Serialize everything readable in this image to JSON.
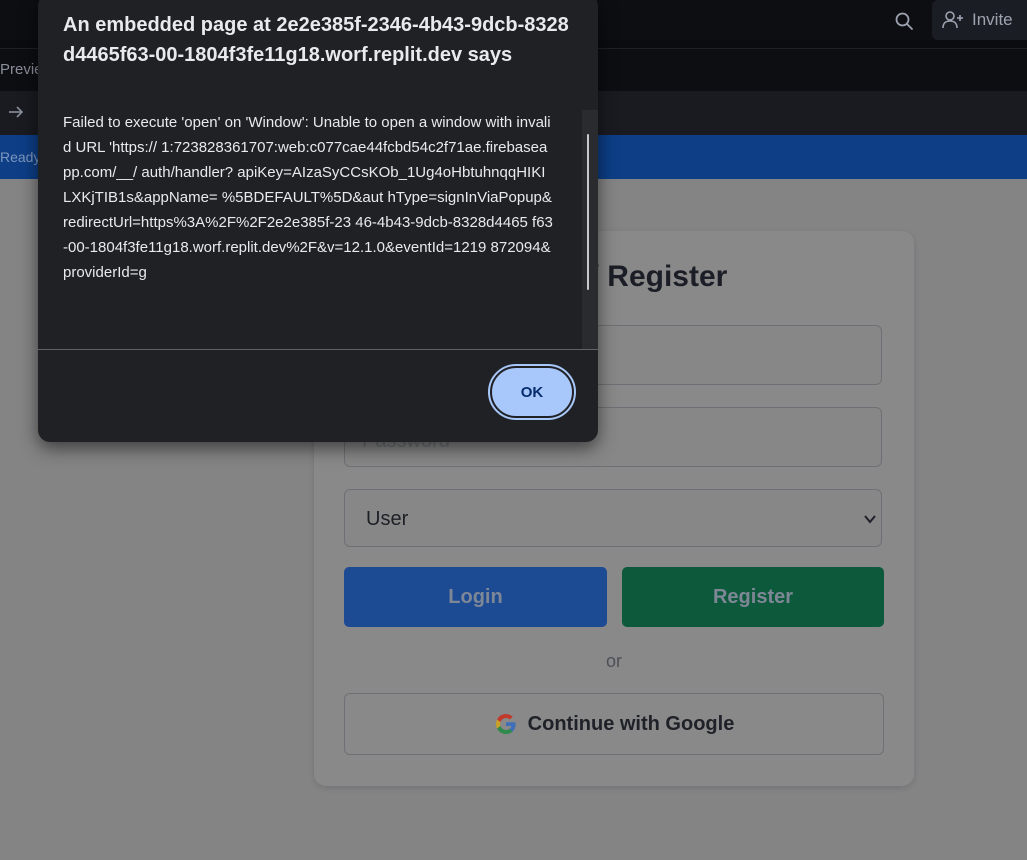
{
  "workspace": {
    "invite_label": "Invite",
    "preview_tab_label": "Previe",
    "status_text": "Ready"
  },
  "app": {
    "title": "Login / Register",
    "password_placeholder": "Password",
    "role_selected": "User",
    "login_label": "Login",
    "register_label": "Register",
    "or_label": "or",
    "google_label": "Continue with Google"
  },
  "dialog": {
    "title": "An embedded page at 2e2e385f-2346-4b43-9dcb-8328d4465f63-00-1804f3fe11g18.worf.replit.dev says",
    "message": "Failed to execute 'open' on 'Window': Unable to open a window with invalid URL 'https:// 1:723828361707:web:c077cae44fcbd54c2f71ae.firebaseapp.com/__/ auth/handler? apiKey=AIzaSyCCsKOb_1Ug4oHbtuhnqqHIKILXKjTIB1s&appName= %5BDEFAULT%5D&aut hType=signInViaPopup&redirectUrl=https%3A%2F%2F2e2e385f-23 46-4b43-9dcb-8328d4465 f63-00-1804f3fe11g18.worf.replit.dev%2F&v=12.1.0&eventId=1219 872094&providerId=g",
    "ok_label": "OK"
  },
  "colors": {
    "dialog_bg": "#202124",
    "ok_button": "#a8c7fa",
    "login_button": "#1c4a93",
    "register_button": "#0c5a3b",
    "status_bar": "#0d3e86"
  },
  "icons": {
    "search": "search-icon",
    "invite": "person-add-icon",
    "forward": "arrow-right-icon",
    "select": "chevron-down-icon",
    "google": "google-logo-icon"
  }
}
